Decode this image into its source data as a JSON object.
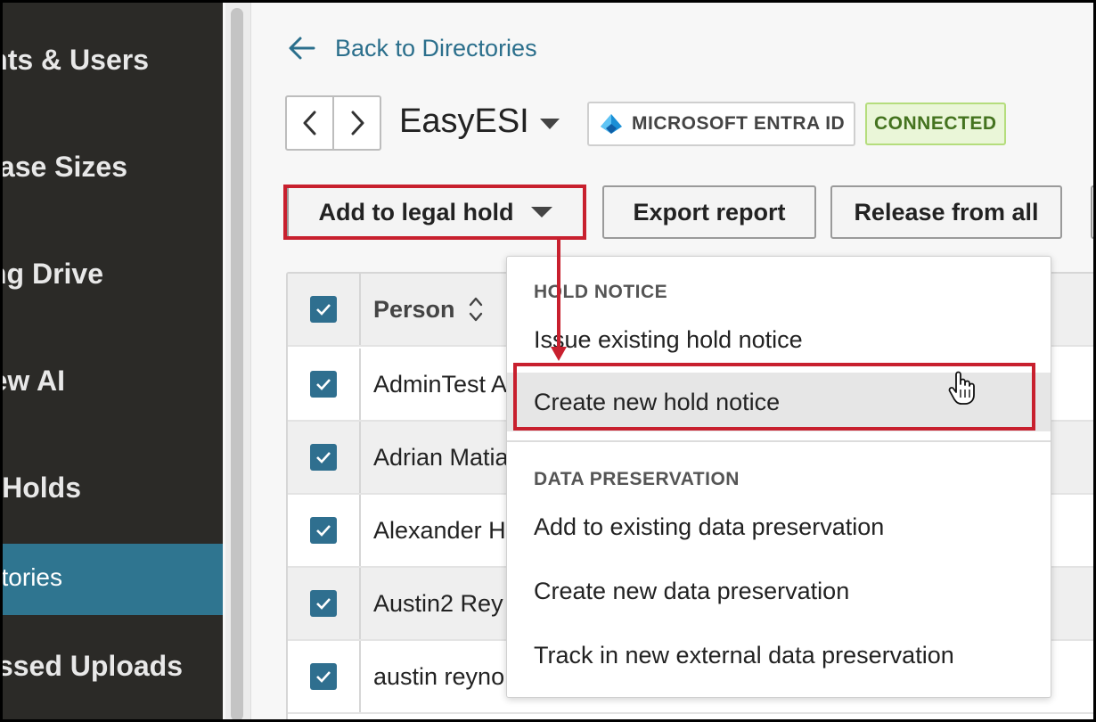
{
  "sidebar": {
    "items": [
      {
        "label": "Accounts & Users",
        "active": false
      },
      {
        "label": "Database Sizes",
        "active": false
      },
      {
        "label": "Staging Drive",
        "active": false
      },
      {
        "label": "Review AI",
        "active": false
      },
      {
        "label": "Legal Holds",
        "active": false
      },
      {
        "label": "Directories",
        "active": true
      },
      {
        "label": "Processed Uploads",
        "active": false
      }
    ]
  },
  "header": {
    "back_link": "Back to Directories",
    "directory_name": "EasyESI",
    "provider": "MICROSOFT ENTRA ID",
    "status": "CONNECTED"
  },
  "toolbar": {
    "add_hold_label": "Add to legal hold",
    "export_label": "Export report",
    "release_label": "Release from all"
  },
  "table": {
    "column_person": "Person",
    "rows": [
      {
        "person": "AdminTest A",
        "checked": true
      },
      {
        "person": "Adrian Matia",
        "checked": true
      },
      {
        "person": "Alexander H",
        "checked": true
      },
      {
        "person": "Austin2 Rey",
        "checked": true
      },
      {
        "person": "austin reyno",
        "checked": true
      }
    ]
  },
  "dropdown": {
    "section1_heading": "HOLD NOTICE",
    "issue_existing": "Issue existing hold notice",
    "create_new": "Create new hold notice",
    "section2_heading": "DATA PRESERVATION",
    "add_existing_preservation": "Add to existing data preservation",
    "create_new_preservation": "Create new data preservation",
    "track_external": "Track in new external data preservation"
  },
  "colors": {
    "accent": "#2f7590",
    "highlight": "#c8202e",
    "link": "#2b6f8c"
  }
}
